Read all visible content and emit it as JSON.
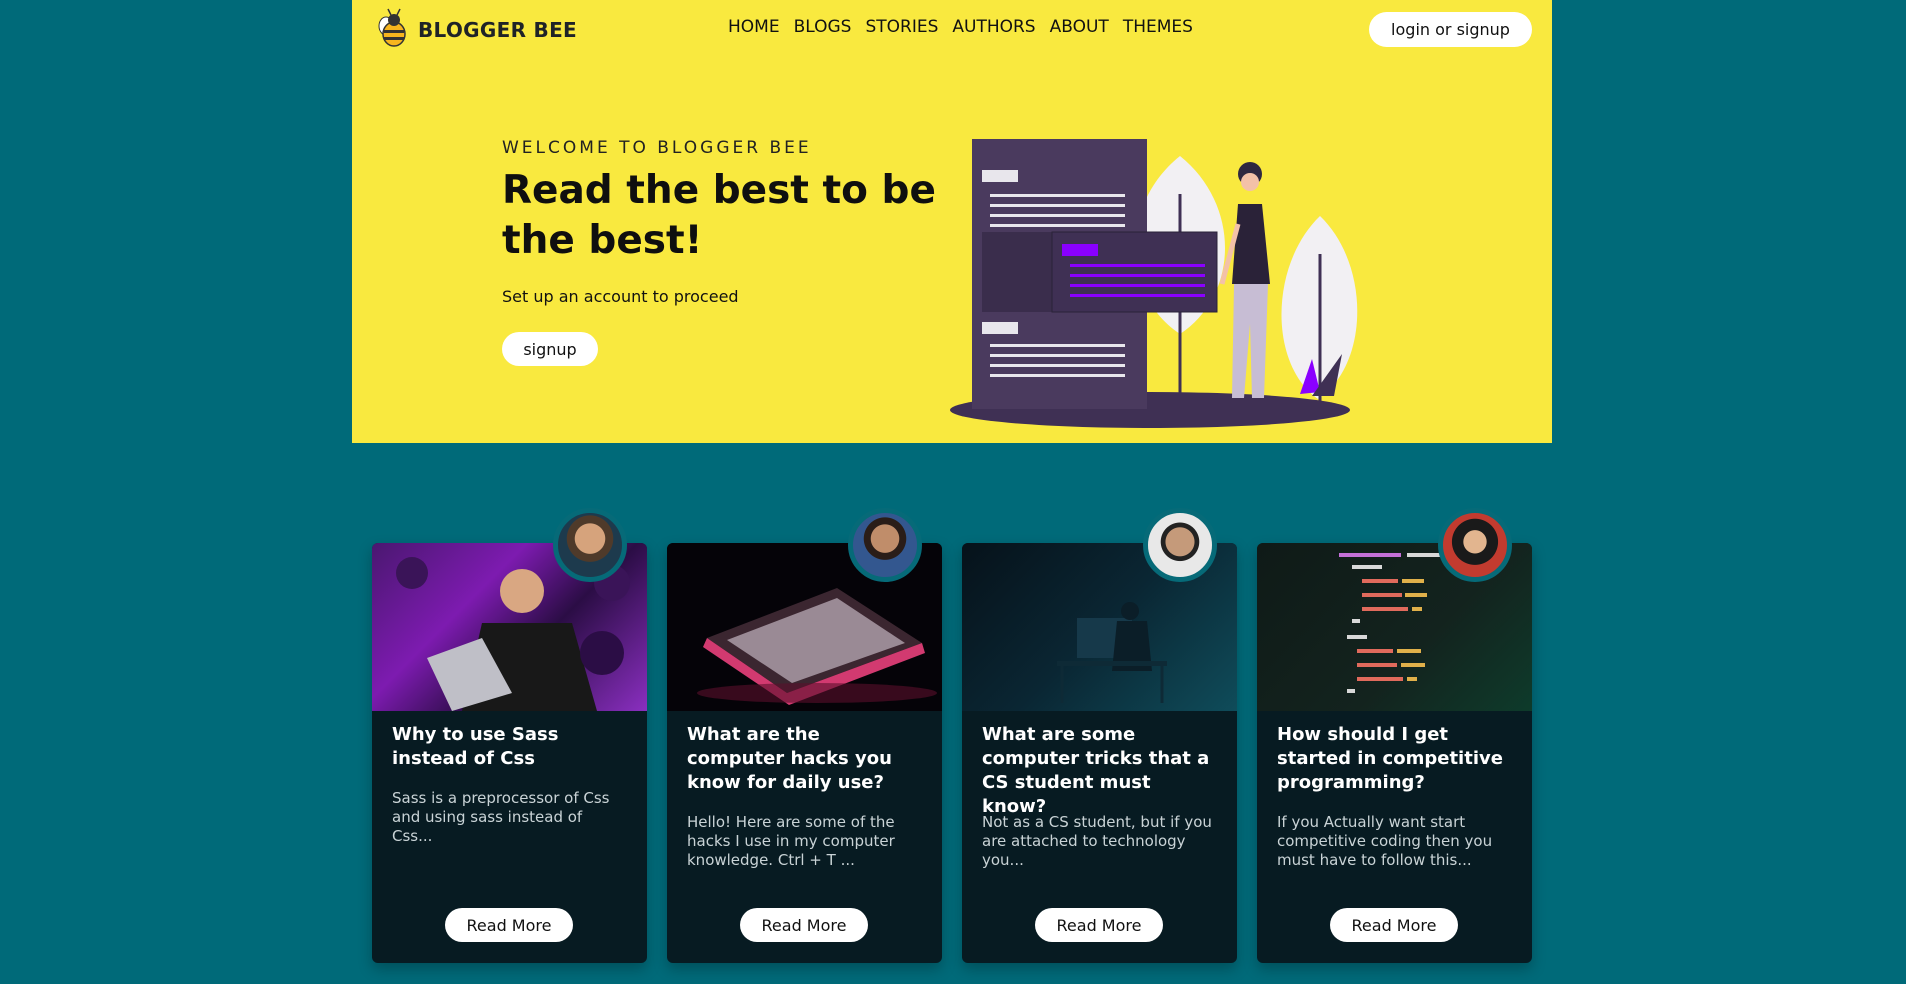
{
  "brand": {
    "name": "BLOGGER BEE"
  },
  "nav": [
    "HOME",
    "BLOGS",
    "STORIES",
    "AUTHORS",
    "ABOUT",
    "THEMES"
  ],
  "auth": {
    "login_label": "login or signup"
  },
  "hero": {
    "eyebrow": "WELCOME TO BLOGGER BEE",
    "headline": "Read the best to be the best!",
    "subtext": "Set up an account to proceed",
    "signup_label": "signup"
  },
  "cards": [
    {
      "title": "Why to use Sass instead of Css",
      "excerpt": "Sass is a preprocessor of Css and using sass instead of Css...",
      "button": "Read More"
    },
    {
      "title": "What are the computer hacks you know for daily use?",
      "excerpt": "Hello! Here are some of the hacks I use in my computer knowledge. Ctrl + T ...",
      "button": "Read More"
    },
    {
      "title": "What are some computer tricks that a CS student must know?",
      "excerpt": "Not as a CS student, but if you are attached to technology you...",
      "button": "Read More"
    },
    {
      "title": "How should I get started in competitive programming?",
      "excerpt": "If you Actually want start competitive coding then you must have to follow this...",
      "button": "Read More"
    }
  ],
  "colors": {
    "page_bg": "#006a79",
    "hero_bg": "#f9e93f",
    "card_bg": "#071b22",
    "accent_purple": "#8a00ff"
  }
}
